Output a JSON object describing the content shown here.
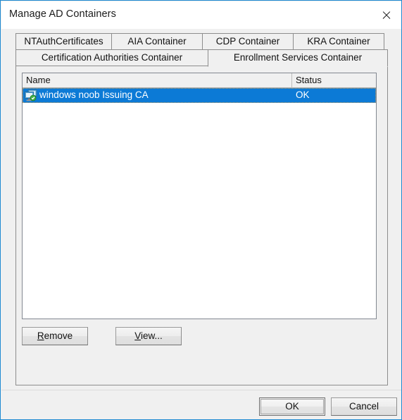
{
  "window": {
    "title": "Manage AD Containers",
    "close_icon": "close-icon",
    "border_color": "#1f8ad2"
  },
  "tabs": {
    "row1": [
      {
        "label": "NTAuthCertificates",
        "selected": false
      },
      {
        "label": "AIA Container",
        "selected": false
      },
      {
        "label": "CDP Container",
        "selected": false
      },
      {
        "label": "KRA Container",
        "selected": false
      }
    ],
    "row2": [
      {
        "label": "Certification Authorities Container",
        "selected": false
      },
      {
        "label": "Enrollment Services Container",
        "selected": true
      }
    ]
  },
  "listview": {
    "columns": [
      {
        "key": "name",
        "label": "Name"
      },
      {
        "key": "status",
        "label": "Status"
      }
    ],
    "rows": [
      {
        "icon": "certification-authority-server-icon",
        "name": "windows noob Issuing CA",
        "status": "OK",
        "selected": true
      }
    ]
  },
  "panel_buttons": {
    "remove": {
      "accel": "R",
      "rest": "emove"
    },
    "view": {
      "accel": "V",
      "rest": "iew..."
    }
  },
  "dialog_buttons": {
    "ok": "OK",
    "cancel": "Cancel"
  },
  "colors": {
    "selection_blue": "#0c7ad6",
    "focus_dotted": "#c8a060",
    "window_chrome": "#f0f0f0",
    "titlebar": "#ffffff"
  }
}
